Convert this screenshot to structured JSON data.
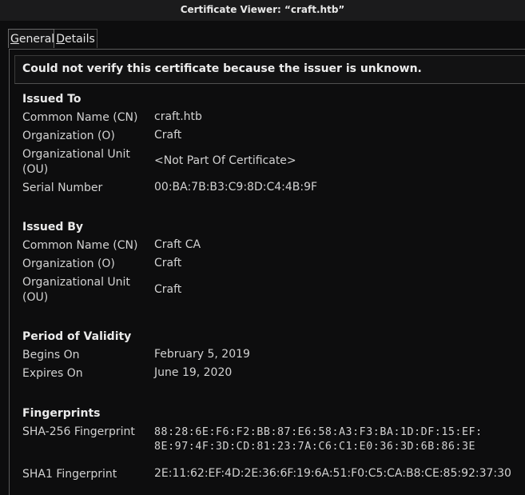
{
  "window": {
    "title": "Certificate Viewer: “craft.htb”"
  },
  "tabs": [
    {
      "label_mnemonic": "G",
      "label_rest": "eneral",
      "active": true
    },
    {
      "label_mnemonic": "D",
      "label_rest": "etails",
      "active": false
    }
  ],
  "warning": "Could not verify this certificate because the issuer is unknown.",
  "issued_to": {
    "title": "Issued To",
    "fields": [
      {
        "label": "Common Name (CN)",
        "value": "craft.htb"
      },
      {
        "label": "Organization (O)",
        "value": "Craft"
      },
      {
        "label": "Organizational Unit (OU)",
        "value": "<Not Part Of Certificate>"
      },
      {
        "label": "Serial Number",
        "value": "00:BA:7B:B3:C9:8D:C4:4B:9F"
      }
    ]
  },
  "issued_by": {
    "title": "Issued By",
    "fields": [
      {
        "label": "Common Name (CN)",
        "value": "Craft CA"
      },
      {
        "label": "Organization (O)",
        "value": "Craft"
      },
      {
        "label": "Organizational Unit (OU)",
        "value": "Craft"
      }
    ]
  },
  "validity": {
    "title": "Period of Validity",
    "fields": [
      {
        "label": "Begins On",
        "value": "February 5, 2019"
      },
      {
        "label": "Expires On",
        "value": "June 19, 2020"
      }
    ]
  },
  "fingerprints": {
    "title": "Fingerprints",
    "sha256": {
      "label": "SHA-256 Fingerprint",
      "line1": "88:28:6E:F6:F2:BB:87:E6:58:A3:F3:BA:1D:DF:15:EF:",
      "line2": "8E:97:4F:3D:CD:81:23:7A:C6:C1:E0:36:3D:6B:86:3E"
    },
    "sha1": {
      "label": "SHA1 Fingerprint",
      "value": "2E:11:62:EF:4D:2E:36:6F:19:6A:51:F0:C5:CA:B8:CE:85:92:37:30"
    }
  }
}
